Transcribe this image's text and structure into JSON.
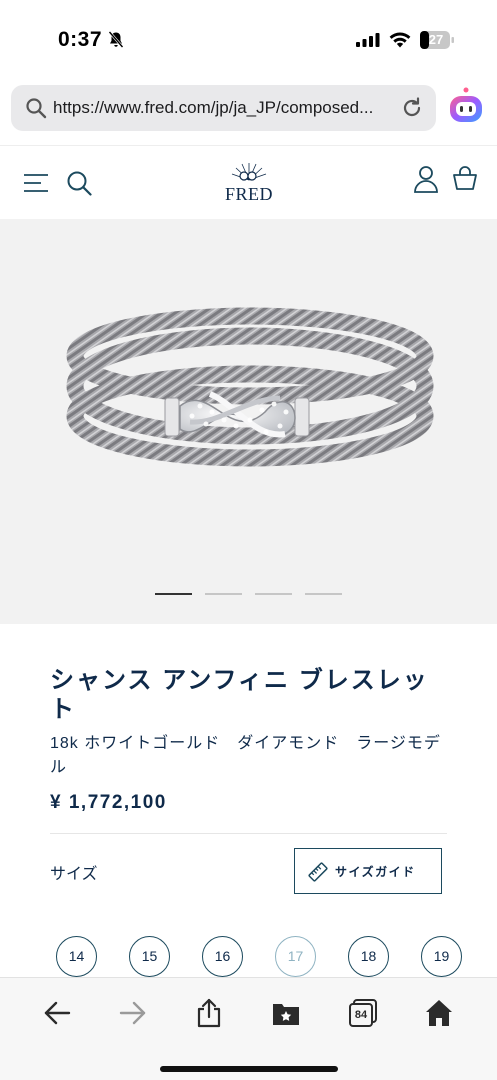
{
  "status_bar": {
    "time": "0:37",
    "battery": "27"
  },
  "browser": {
    "url": "https://www.fred.com/jp/ja_JP/composed...",
    "icons": [
      "search-icon",
      "reload-icon",
      "ai-assistant-icon"
    ]
  },
  "header": {
    "logo_text": "FRED",
    "icons": [
      "menu-icon",
      "search-icon",
      "account-icon",
      "cart-icon"
    ]
  },
  "gallery": {
    "slide_count": 4,
    "active_index": 0
  },
  "product": {
    "title": "シャンス アンフィニ ブレスレット",
    "subtitle": "18k ホワイトゴールド　ダイアモンド　ラージモデル",
    "price": "¥ 1,772,100",
    "size_label": "サイズ",
    "size_guide_label": "サイズガイド",
    "sizes": [
      {
        "label": "14",
        "available": true
      },
      {
        "label": "15",
        "available": true
      },
      {
        "label": "16",
        "available": true
      },
      {
        "label": "17",
        "available": false
      },
      {
        "label": "18",
        "available": true
      },
      {
        "label": "19",
        "available": true
      }
    ]
  },
  "toolbar": {
    "tabs_count": "84",
    "icons": [
      "back-arrow-icon",
      "forward-arrow-icon",
      "share-icon",
      "bookmarks-icon",
      "tabs-icon",
      "home-icon"
    ]
  },
  "colors": {
    "brand_navy": "#0f2a4a",
    "accent_teal": "#1c4a5e",
    "disabled": "#8fb3c2"
  }
}
